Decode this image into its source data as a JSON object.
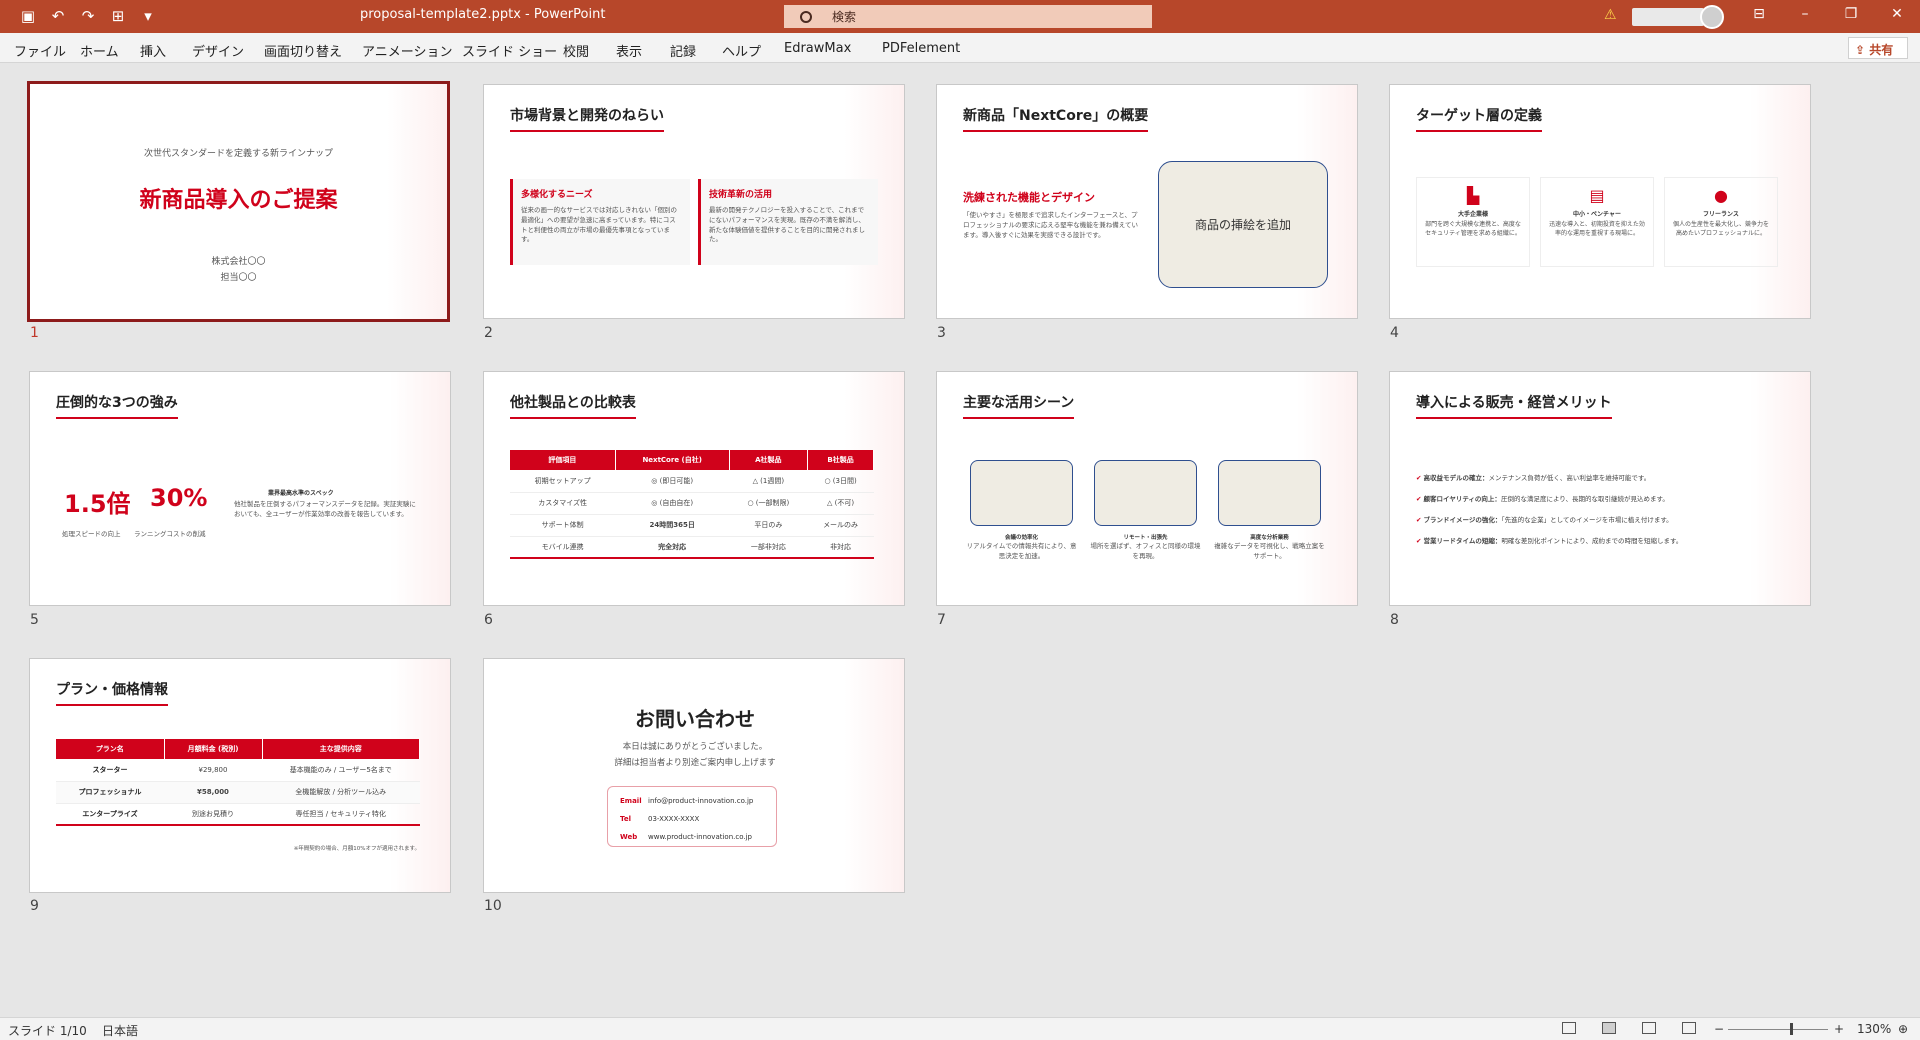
{
  "window": {
    "title": "proposal-template2.pptx  -  PowerPoint",
    "search_placeholder": "検索",
    "share_label": "共有"
  },
  "menu": [
    "ファイル",
    "ホーム",
    "挿入",
    "デザイン",
    "画面切り替え",
    "アニメーション",
    "スライド ショー",
    "校閲",
    "表示",
    "記録",
    "ヘルプ",
    "EdrawMax",
    "PDFelement"
  ],
  "slides": {
    "s1": {
      "num": "1",
      "subtitle": "次世代スタンダードを定義する新ラインナップ",
      "title": "新商品導入のご提案",
      "company": "株式会社〇〇",
      "person": "担当〇〇"
    },
    "s2": {
      "num": "2",
      "title": "市場背景と開発のねらい",
      "c1_title": "多様化するニーズ",
      "c1_body": "従来の画一的なサービスでは対応しきれない「個別の最適化」への要望が急速に高まっています。特にコストと利便性の両立が市場の最優先事項となっています。",
      "c2_title": "技術革新の活用",
      "c2_body": "最新の開発テクノロジーを投入することで、これまでにないパフォーマンスを実現。既存の不満を解消し、新たな体験価値を提供することを目的に開発されました。"
    },
    "s3": {
      "num": "3",
      "title": "新商品「NextCore」の概要",
      "heading": "洗練された機能とデザイン",
      "body": "「使いやすさ」を極限まで追求したインターフェースと、プロフェッショナルの要求に応える堅牢な機能を兼ね備えています。導入後すぐに効果を実感できる設計です。",
      "placeholder": "商品の挿絵を追加"
    },
    "s4": {
      "num": "4",
      "title": "ターゲット層の定義",
      "cards": [
        {
          "title": "大手企業様",
          "body": "部門を跨ぐ大規模な連携と、高度なセキュリティ管理を求める組織に。"
        },
        {
          "title": "中小・ベンチャー",
          "body": "迅速な導入と、初期投資を抑えた効率的な運用を重視する現場に。"
        },
        {
          "title": "フリーランス",
          "body": "個人の生産性を最大化し、競争力を高めたいプロフェッショナルに。"
        }
      ]
    },
    "s5": {
      "num": "5",
      "title": "圧倒的な3つの強み",
      "stat1": "1.5倍",
      "stat1_label": "処理スピードの向上",
      "stat2": "30%",
      "stat2_label": "ランニングコストの削減",
      "spec_title": "業界最高水準のスペック",
      "spec_body": "他社製品を圧倒するパフォーマンスデータを記録。実証実験においても、全ユーザーが作業効率の改善を報告しています。"
    },
    "s6": {
      "num": "6",
      "title": "他社製品との比較表",
      "headers": [
        "評価項目",
        "NextCore (自社)",
        "A社製品",
        "B社製品"
      ],
      "rows": [
        [
          "初期セットアップ",
          "◎ (即日可能)",
          "△ (1週間)",
          "○ (3日間)"
        ],
        [
          "カスタマイズ性",
          "◎ (自由自在)",
          "○ (一部制限)",
          "△ (不可)"
        ],
        [
          "サポート体制",
          "24時間365日",
          "平日のみ",
          "メールのみ"
        ],
        [
          "モバイル連携",
          "完全対応",
          "一部非対応",
          "非対応"
        ]
      ]
    },
    "s7": {
      "num": "7",
      "title": "主要な活用シーン",
      "scenes": [
        {
          "title": "会議の効率化",
          "body": "リアルタイムでの情報共有により、意思決定を加速。"
        },
        {
          "title": "リモート・出張先",
          "body": "場所を選ばず、オフィスと同様の環境を再現。"
        },
        {
          "title": "高度な分析業務",
          "body": "複雑なデータを可視化し、戦略立案をサポート。"
        }
      ]
    },
    "s8": {
      "num": "8",
      "title": "導入による販売・経営メリット",
      "items": [
        {
          "label": "高収益モデルの確立：",
          "text": "メンテナンス負荷が低く、高い利益率を維持可能です。"
        },
        {
          "label": "顧客ロイヤリティの向上：",
          "text": "圧倒的な満足度により、長期的な取引継続が見込めます。"
        },
        {
          "label": "ブランドイメージの強化：",
          "text": "「先進的な企業」としてのイメージを市場に植え付けます。"
        },
        {
          "label": "営業リードタイムの短縮：",
          "text": "明確な差別化ポイントにより、成約までの時間を短縮します。"
        }
      ]
    },
    "s9": {
      "num": "9",
      "title": "プラン・価格情報",
      "headers": [
        "プラン名",
        "月額料金 (税別)",
        "主な提供内容"
      ],
      "rows": [
        [
          "スターター",
          "¥29,800",
          "基本機能のみ / ユーザー5名まで"
        ],
        [
          "プロフェッショナル",
          "¥58,000",
          "全機能解放 / 分析ツール込み"
        ],
        [
          "エンタープライズ",
          "別途お見積り",
          "専任担当 / セキュリティ特化"
        ]
      ],
      "note": "※年間契約の場合、月額10%オフが適用されます。"
    },
    "s10": {
      "num": "10",
      "title": "お問い合わせ",
      "line1": "本日は誠にありがとうございました。",
      "line2": "詳細は担当者より別途ご案内申し上げます",
      "email_label": "Email",
      "email": "info@product-innovation.co.jp",
      "tel_label": "Tel",
      "tel": "03-XXXX-XXXX",
      "web_label": "Web",
      "web": "www.product-innovation.co.jp"
    }
  },
  "status": {
    "slide": "スライド 1/10",
    "lang": "日本語",
    "zoom": "130%"
  }
}
